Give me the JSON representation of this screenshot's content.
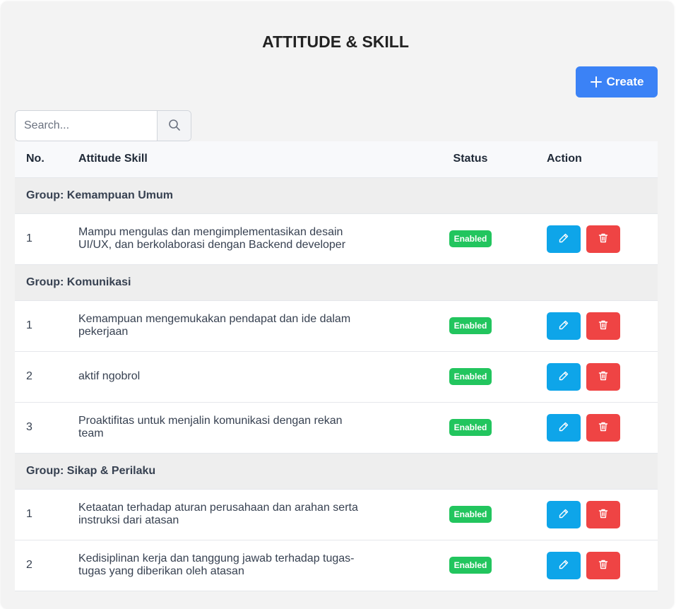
{
  "page": {
    "title": "ATTITUDE & SKILL",
    "create_label": "Create"
  },
  "search": {
    "placeholder": "Search..."
  },
  "table": {
    "headers": {
      "no": "No.",
      "skill": "Attitude Skill",
      "status": "Status",
      "action": "Action"
    },
    "groups": [
      {
        "label": "Group: Kemampuan Umum",
        "rows": [
          {
            "no": "1",
            "skill": "Mampu mengulas dan mengimplementasikan desain UI/UX, dan berkolaborasi dengan Backend developer",
            "status": "Enabled"
          }
        ]
      },
      {
        "label": "Group: Komunikasi",
        "rows": [
          {
            "no": "1",
            "skill": "Kemampuan mengemukakan pendapat dan ide dalam pekerjaan",
            "status": "Enabled"
          },
          {
            "no": "2",
            "skill": "aktif ngobrol",
            "status": "Enabled"
          },
          {
            "no": "3",
            "skill": "Proaktifitas untuk menjalin komunikasi dengan rekan team",
            "status": "Enabled"
          }
        ]
      },
      {
        "label": "Group: Sikap & Perilaku",
        "rows": [
          {
            "no": "1",
            "skill": "Ketaatan terhadap aturan perusahaan dan arahan serta instruksi dari atasan",
            "status": "Enabled"
          },
          {
            "no": "2",
            "skill": "Kedisiplinan kerja dan tanggung jawab terhadap tugas-tugas yang diberikan oleh atasan",
            "status": "Enabled"
          }
        ]
      }
    ]
  },
  "icons": {
    "create": "plus-icon",
    "search": "search-icon",
    "edit": "pencil-icon",
    "delete": "trash-icon"
  },
  "colors": {
    "primary": "#3b82f6",
    "edit": "#0ea5e9",
    "delete": "#ef4444",
    "enabled": "#22c55e"
  }
}
